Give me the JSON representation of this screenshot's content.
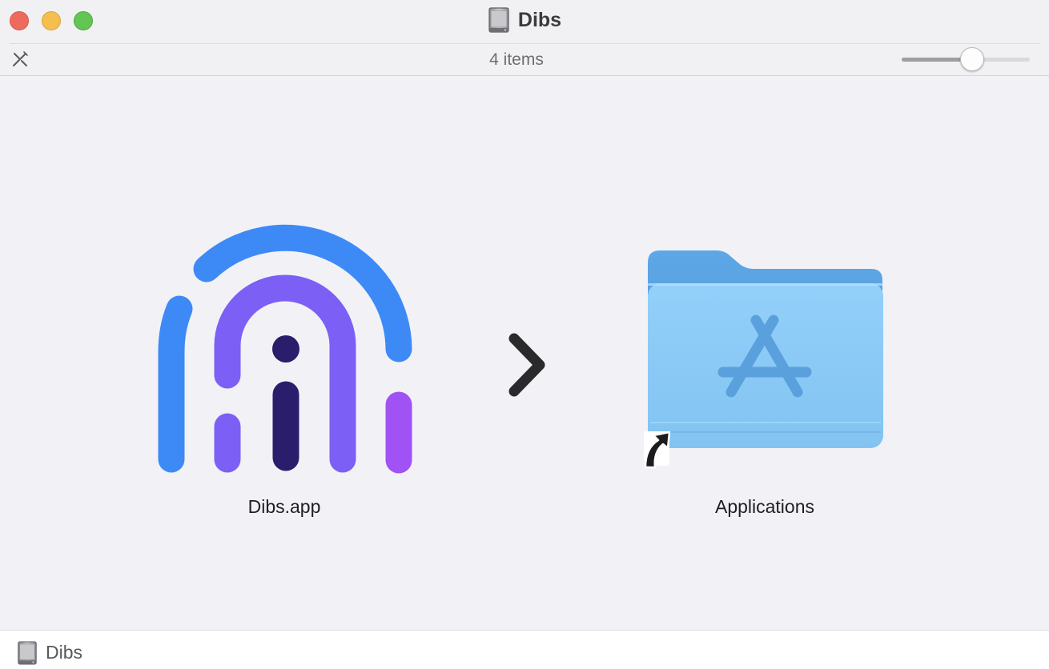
{
  "window": {
    "title": "Dibs",
    "title_icon": "disk-image-icon"
  },
  "traffic_lights": {
    "close": "#ee6a5f",
    "minimize": "#f5bf4f",
    "zoom": "#62c554"
  },
  "toolbar": {
    "tool_icon": "hide-toolbar-icon",
    "items_count": "4 items",
    "icon_size_slider": {
      "value": 0.55
    }
  },
  "content": {
    "items": [
      {
        "label": "Dibs.app",
        "icon": "dibs-app-icon"
      },
      {
        "label": "Applications",
        "icon": "applications-folder-alias-icon"
      }
    ],
    "arrow_icon": "chevron-right-icon"
  },
  "colors": {
    "dibs_blue": "#3d8af7",
    "dibs_purple": "#7c5ff5",
    "dibs_dark": "#2a1d6b",
    "dibs_violet": "#a052f5",
    "folder_blue": "#8ccbf7"
  },
  "statusbar": {
    "path_icon": "disk-image-icon",
    "path_label": "Dibs"
  }
}
